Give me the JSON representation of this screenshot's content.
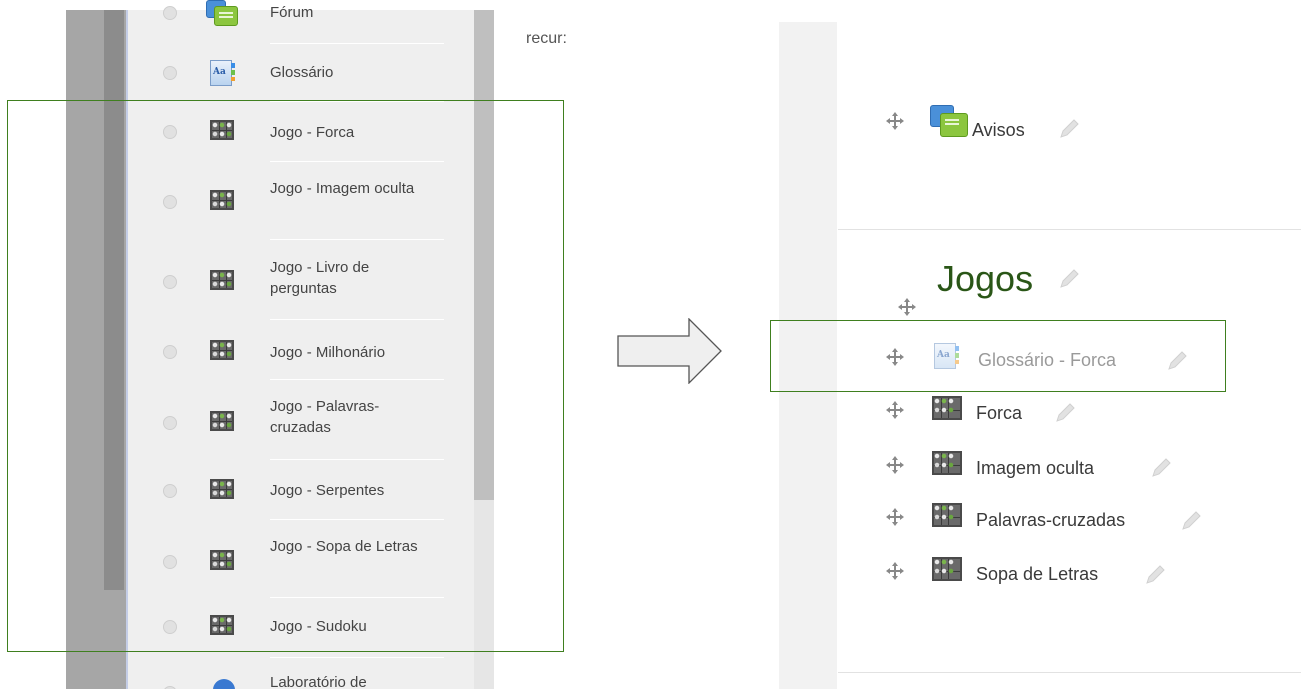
{
  "left_panel": {
    "recurs_text": "recur:",
    "items": [
      {
        "label": "Fórum",
        "icon": "forum-icon"
      },
      {
        "label": "Glossário",
        "icon": "glossary-icon"
      },
      {
        "label": "Jogo - Forca",
        "icon": "game-icon"
      },
      {
        "label": "Jogo - Imagem oculta",
        "icon": "game-icon"
      },
      {
        "label": "Jogo - Livro de perguntas",
        "icon": "game-icon"
      },
      {
        "label": "Jogo - Milhonário",
        "icon": "game-icon"
      },
      {
        "label": "Jogo - Palavras-cruzadas",
        "icon": "game-icon"
      },
      {
        "label": "Jogo - Serpentes",
        "icon": "game-icon"
      },
      {
        "label": "Jogo - Sopa de Letras",
        "icon": "game-icon"
      },
      {
        "label": "Jogo - Sudoku",
        "icon": "game-icon"
      },
      {
        "label": "Laboratório de",
        "icon": "info-icon"
      }
    ]
  },
  "right_panel": {
    "announcements": "Avisos",
    "section_title": "Jogos",
    "activities": [
      {
        "label": "Glossário - Forca",
        "icon": "glossary-icon",
        "dimmed": true
      },
      {
        "label": "Forca",
        "icon": "game-icon",
        "dimmed": false
      },
      {
        "label": "Imagem oculta",
        "icon": "game-icon",
        "dimmed": false
      },
      {
        "label": "Palavras-cruzadas",
        "icon": "game-icon",
        "dimmed": false
      },
      {
        "label": "Sopa de Letras",
        "icon": "game-icon",
        "dimmed": false
      }
    ]
  },
  "colors": {
    "highlight_frame": "#3f7f1f",
    "section_title": "#2a5617"
  }
}
